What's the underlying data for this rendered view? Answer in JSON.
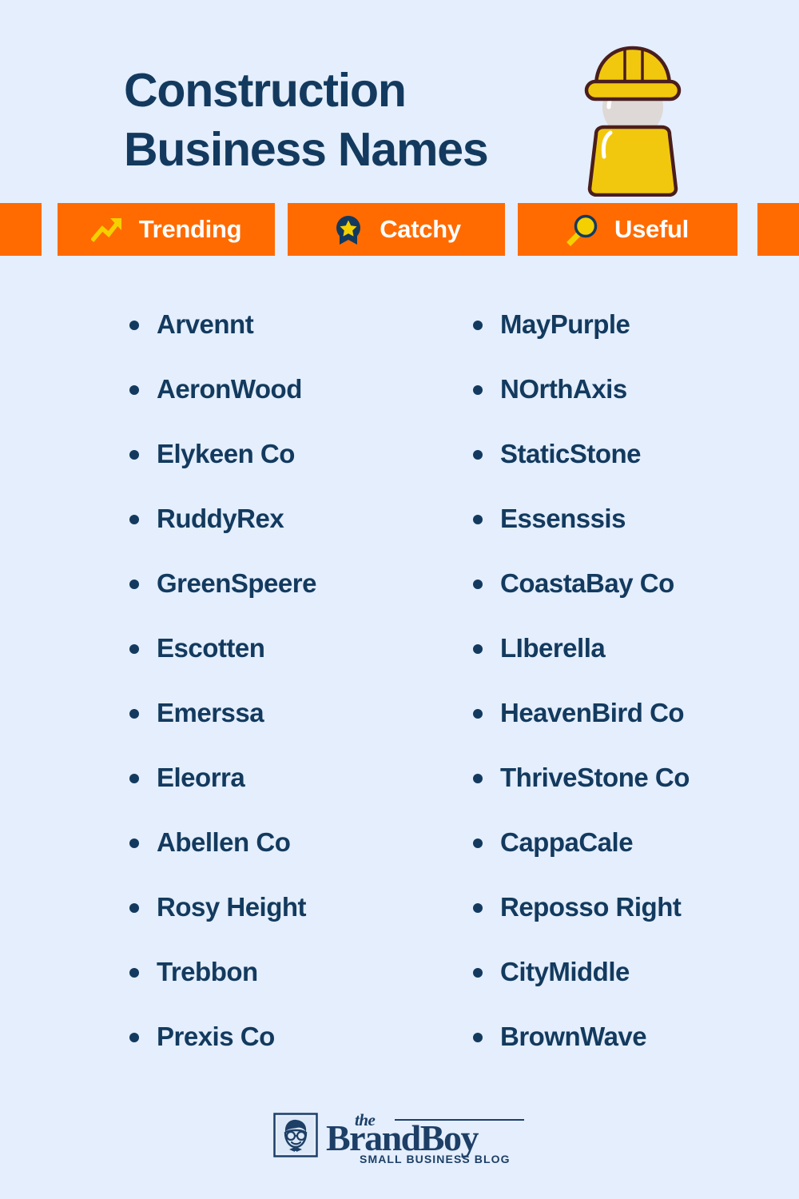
{
  "colors": {
    "background": "#e4eefd",
    "navy": "#133a5e",
    "orange": "#ff6b00",
    "yellow": "#f5d000",
    "white": "#ffffff",
    "hat_outline": "#4a1e1e",
    "face": "#ded9d6"
  },
  "header": {
    "title_line1": "Construction",
    "title_line2": "Business Names",
    "hero_icon": "construction-worker-icon"
  },
  "banner": {
    "categories": [
      {
        "label": "Trending",
        "icon": "trending-arrow-icon"
      },
      {
        "label": "Catchy",
        "icon": "award-ribbon-star-icon"
      },
      {
        "label": "Useful",
        "icon": "magnifying-glass-icon"
      }
    ]
  },
  "lists": {
    "left_column": [
      "Arvennt",
      "AeronWood",
      "Elykeen Co",
      "RuddyRex",
      "GreenSpeere",
      "Escotten",
      "Emerssa",
      "Eleorra",
      "Abellen Co",
      "Rosy Height",
      "Trebbon",
      "Prexis Co"
    ],
    "right_column": [
      "MayPurple",
      "NOrthAxis",
      "StaticStone",
      "Essenssis",
      "CoastaBay Co",
      "LIberella",
      "HeavenBird Co",
      "ThriveStone Co",
      "CappaCale",
      "Reposso Right",
      "CityMiddle",
      "BrownWave"
    ]
  },
  "footer": {
    "logo_mark": "brandboy-face-icon",
    "logo_the": "the",
    "logo_name": "BrandBoy",
    "logo_tagline": "SMALL BUSINESS BLOG"
  }
}
